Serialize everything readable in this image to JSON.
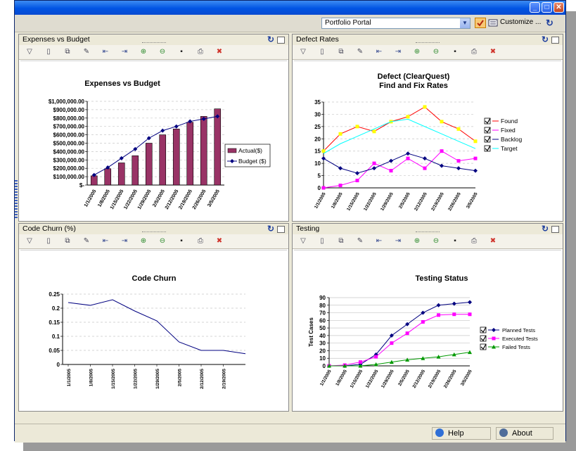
{
  "window": {
    "buttons": {
      "minimize": "_",
      "maximize": "□",
      "close": "✕"
    }
  },
  "toolbar": {
    "portal_select": "Portfolio Portal",
    "customize_label": "Customize ...",
    "icons": [
      "checkbox-toggle-icon",
      "list-view-icon",
      "refresh-icon"
    ]
  },
  "panel_tool_icons": [
    "filter-icon",
    "new-page-icon",
    "copy-icon",
    "edit-icon",
    "move-left-icon",
    "move-right-icon",
    "zoom-in-icon",
    "zoom-out-icon",
    "save-icon",
    "print-icon",
    "delete-icon"
  ],
  "panels": {
    "expenses": {
      "title": "Expenses vs Budget"
    },
    "defects": {
      "title": "Defect Rates"
    },
    "churn": {
      "title": "Code Churn (%)"
    },
    "testing": {
      "title": "Testing"
    }
  },
  "status": {
    "help_label": "Help",
    "about_label": "About"
  },
  "colors": {
    "bar": "#993366",
    "budget_line": "#000080",
    "found": "#ff0000",
    "fixed": "#ff00ff",
    "backlog": "#000080",
    "target": "#00ffff",
    "planned": "#000080",
    "executed": "#ff00ff",
    "failed": "#009900",
    "titlebar": "#0054e3"
  },
  "chart_data": [
    {
      "id": "expenses",
      "type": "bar",
      "title": "Expenses vs Budget",
      "categories": [
        "1/1/2005",
        "1/8/2005",
        "1/15/2005",
        "1/22/2005",
        "1/29/2005",
        "2/5/2005",
        "2/12/2005",
        "2/19/2005",
        "2/26/2005",
        "3/5/2005"
      ],
      "y_ticks": [
        "$1,000,000.00",
        "$900,000.00",
        "$800,000.00",
        "$700,000.00",
        "$600,000.00",
        "$500,000.00",
        "$400,000.00",
        "$300,000.00",
        "$200,000.00",
        "$100,000.00",
        "$-"
      ],
      "ylim": [
        0,
        1000000
      ],
      "series": [
        {
          "name": "Actual($)",
          "kind": "bar",
          "values": [
            110000,
            195000,
            265000,
            350000,
            500000,
            600000,
            670000,
            750000,
            820000,
            910000
          ]
        },
        {
          "name": "Budget ($)",
          "kind": "line",
          "values": [
            120000,
            210000,
            320000,
            430000,
            560000,
            650000,
            700000,
            760000,
            790000,
            820000
          ]
        }
      ],
      "legend": "right"
    },
    {
      "id": "defects",
      "type": "line",
      "title": "Defect (ClearQuest)",
      "subtitle": "Find and Fix Rates",
      "categories": [
        "1/1/2005",
        "1/8/2005",
        "1/15/2005",
        "1/22/2005",
        "1/29/2005",
        "2/5/2005",
        "2/12/2005",
        "2/19/2005",
        "2/26/2005",
        "3/5/2005"
      ],
      "ylim": [
        0,
        35
      ],
      "y_ticks": [
        "35",
        "30",
        "25",
        "20",
        "15",
        "10",
        "5",
        "0"
      ],
      "series": [
        {
          "name": "Found",
          "values": [
            15,
            22,
            25,
            23,
            27,
            29,
            33,
            27,
            24,
            19
          ]
        },
        {
          "name": "Fixed",
          "values": [
            0,
            1,
            3,
            10,
            7,
            12,
            8,
            15,
            11,
            12
          ]
        },
        {
          "name": "Backlog",
          "values": [
            12,
            8,
            6,
            8,
            11,
            14,
            12,
            9,
            8,
            7
          ]
        },
        {
          "name": "Target",
          "values": [
            14,
            18,
            21,
            24,
            27,
            28,
            25,
            22,
            19,
            16
          ]
        }
      ],
      "legend": "right"
    },
    {
      "id": "churn",
      "type": "line",
      "title": "Code Churn",
      "categories": [
        "1/1/2005",
        "1/8/2005",
        "1/15/2005",
        "1/22/2005",
        "1/29/2005",
        "2/5/2005",
        "2/12/2005",
        "2/19/2005"
      ],
      "ylim": [
        0,
        0.25
      ],
      "y_ticks": [
        "0.25",
        "0.2",
        "0.15",
        "0.1",
        "0.05",
        "0"
      ],
      "series": [
        {
          "values": [
            0.22,
            0.21,
            0.23,
            0.19,
            0.155,
            0.08,
            0.05,
            0.05,
            0.038
          ]
        }
      ]
    },
    {
      "id": "testing",
      "type": "line",
      "title": "Testing Status",
      "ylabel": "Test Cases",
      "categories": [
        "1/1/2005",
        "1/8/2005",
        "1/15/2005",
        "1/22/2005",
        "1/29/2005",
        "2/5/2005",
        "2/12/2005",
        "2/19/2005",
        "2/26/2005",
        "3/5/2005"
      ],
      "ylim": [
        0,
        90
      ],
      "y_ticks": [
        "90",
        "80",
        "70",
        "60",
        "50",
        "40",
        "30",
        "20",
        "10",
        "0"
      ],
      "series": [
        {
          "name": "Planned Tests",
          "values": [
            0,
            0,
            2,
            15,
            40,
            55,
            70,
            80,
            82,
            84
          ]
        },
        {
          "name": "Executed Tests",
          "values": [
            0,
            1,
            5,
            12,
            30,
            43,
            58,
            67,
            68,
            68
          ]
        },
        {
          "name": "Failed Tests",
          "values": [
            0,
            0,
            0,
            2,
            5,
            8,
            10,
            12,
            15,
            18
          ]
        }
      ],
      "legend": "right"
    }
  ]
}
